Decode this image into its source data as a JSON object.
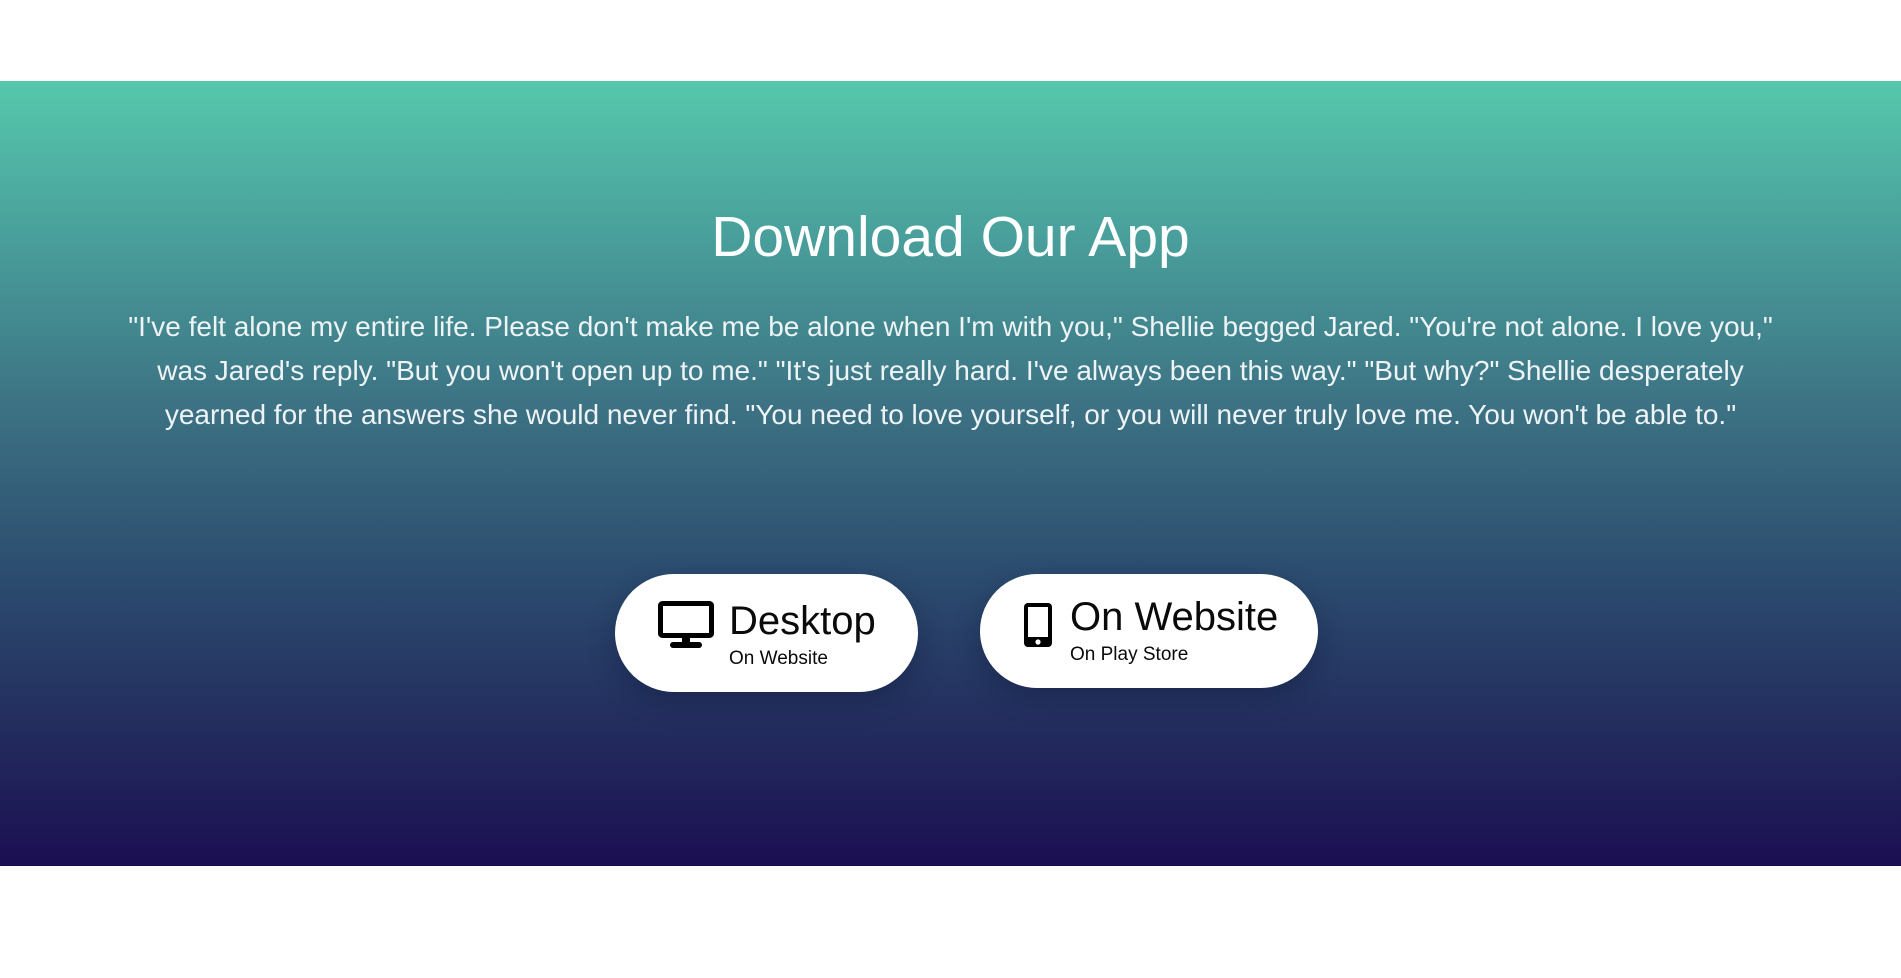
{
  "download": {
    "title": "Download Our App",
    "quote": "\"I've felt alone my entire life. Please don't make me be alone when I'm with you,\" Shellie begged Jared. \"You're not alone. I love you,\" was Jared's reply. \"But you won't open up to me.\" \"It's just really hard. I've always been this way.\" \"But why?\" Shellie desperately yearned for the answers she would never find. \"You need to love yourself, or you will never truly love me. You won't be able to.\"",
    "buttons": [
      {
        "icon": "desktop-monitor-icon",
        "title": "Desktop",
        "subtitle": "On Website"
      },
      {
        "icon": "mobile-phone-icon",
        "title": "On Website",
        "subtitle": "On Play Store"
      }
    ]
  },
  "colors": {
    "gradient_top": "#56c8ac",
    "gradient_bottom": "#1b0f52",
    "button_background": "#ffffff",
    "text_on_gradient": "#ffffff"
  }
}
